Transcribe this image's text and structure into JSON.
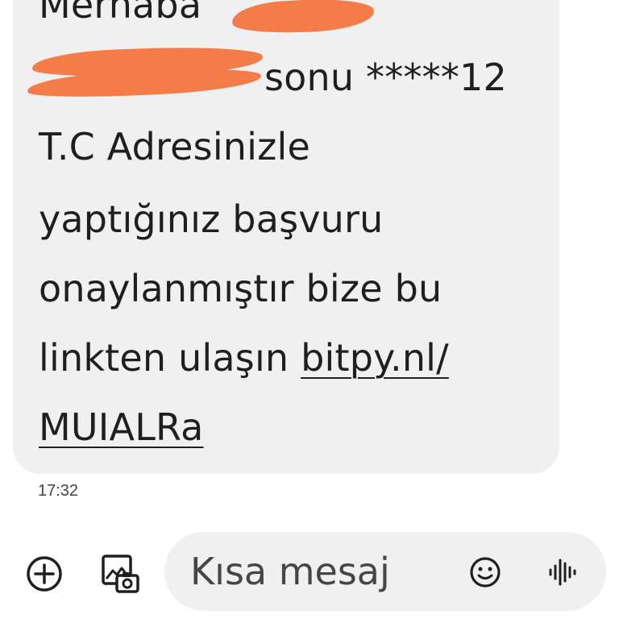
{
  "message": {
    "lines": [
      "Merhaba",
      "sonu *****12",
      "T.C Adresinizle",
      "yaptığınız başvuru",
      "onaylanmıştır bize bu",
      "linkten ulaşın "
    ],
    "link_part1": "bitpy.nl/",
    "link_part2": "MUIALRa",
    "timestamp": "17:32"
  },
  "composer": {
    "placeholder": "Kısa mesaj"
  },
  "icons": {
    "add": "add-circle-icon",
    "gallery": "gallery-camera-icon",
    "emoji": "emoji-icon",
    "voice": "voice-waveform-icon"
  },
  "colors": {
    "bubble": "#f0f0f0",
    "redaction": "#f47c48",
    "text": "#1f1f1f"
  }
}
